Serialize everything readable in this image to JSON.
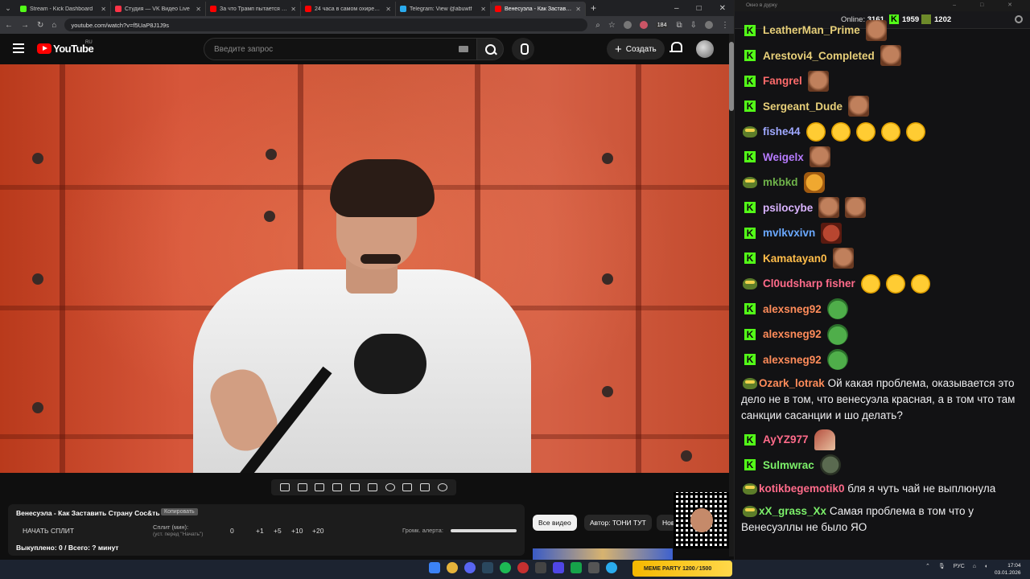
{
  "browser": {
    "tabs": [
      {
        "title": "Stream - Kick Dashboard",
        "color": "#53fc18",
        "active": false
      },
      {
        "title": "Студия — VK Видео Live",
        "color": "#ff3347",
        "active": false
      },
      {
        "title": "За что Трамп пытается убить В",
        "color": "#ff0000",
        "active": false
      },
      {
        "title": "24 часа в самом охиревшем ...",
        "color": "#ff0000",
        "active": false
      },
      {
        "title": "Telegram: View @abuwtf",
        "color": "#2aabee",
        "active": false
      },
      {
        "title": "Венесуэла - Как Заставить ...",
        "color": "#ff0000",
        "active": true
      }
    ],
    "url": "youtube.com/watch?v=f5UaP8J1J9s",
    "ext_badge": "184"
  },
  "youtube": {
    "logo_text": "YouTube",
    "region": "RU",
    "search_placeholder": "Введите запрос",
    "create_label": "Создать"
  },
  "player_panel": {
    "title": "Венесуэла - Как Заставить Страну Сос&ть",
    "copy_label": "Копировать",
    "start_label": "НАЧАТЬ СПЛИТ",
    "split_label": "Сплит (мин):",
    "split_hint": "(уст. перед \"Начать\")",
    "split_value": "0",
    "increments": [
      "+1",
      "+5",
      "+10",
      "+20"
    ],
    "volume_label": "Громк. алерта:",
    "volume_level": 1.0,
    "stats": "Выкуплено: 0 / Всего: ? минут"
  },
  "chips": [
    "Все видео",
    "Автор: ТОНИ ТУТ",
    "Новые"
  ],
  "chat": {
    "window_title": "Окно в дурку",
    "online_label": "Online:",
    "online_count": "3161",
    "kick_count": "1959",
    "points_count": "1202",
    "messages": [
      {
        "badge": "kick",
        "user": "LeatherMan_Prime",
        "color": "#e8d07a",
        "emotes": [
          "face"
        ],
        "text": ""
      },
      {
        "badge": "kick",
        "user": "Arestovi4_Completed",
        "color": "#e8d07a",
        "emotes": [
          "face"
        ],
        "text": ""
      },
      {
        "badge": "kick",
        "user": "Fangrel",
        "color": "#ff6b6b",
        "emotes": [
          "face"
        ],
        "text": ""
      },
      {
        "badge": "kick",
        "user": "Sergeant_Dude",
        "color": "#e8d07a",
        "emotes": [
          "face"
        ],
        "text": ""
      },
      {
        "badge": "pepe",
        "user": "fishe44",
        "color": "#9fa8ff",
        "emotes": [
          "lol",
          "lol",
          "lol",
          "lol",
          "lol"
        ],
        "text": ""
      },
      {
        "badge": "kick",
        "user": "Weigelx",
        "color": "#b77bff",
        "emotes": [
          "face"
        ],
        "text": ""
      },
      {
        "badge": "pepe",
        "user": "mkbkd",
        "color": "#6fb34a",
        "emotes": [
          "tiger"
        ],
        "text": ""
      },
      {
        "badge": "kick",
        "user": "psilocybe",
        "color": "#d9b3ff",
        "emotes": [
          "face",
          "face"
        ],
        "text": ""
      },
      {
        "badge": "kick",
        "user": "mvlkvxivn",
        "color": "#6aa8ff",
        "emotes": [
          "red"
        ],
        "text": ""
      },
      {
        "badge": "kick",
        "user": "Kamatayan0",
        "color": "#ffbd4a",
        "emotes": [
          "face"
        ],
        "text": ""
      },
      {
        "badge": "pepe",
        "user": "Cl0udsharp fisher",
        "color": "#ff6b8a",
        "emotes": [
          "lol",
          "lol",
          "lol"
        ],
        "text": ""
      },
      {
        "badge": "kick",
        "user": "alexsneg92",
        "color": "#ff8c5a",
        "emotes": [
          "frog"
        ],
        "text": ""
      },
      {
        "badge": "kick",
        "user": "alexsneg92",
        "color": "#ff8c5a",
        "emotes": [
          "frog"
        ],
        "text": ""
      },
      {
        "badge": "kick",
        "user": "alexsneg92",
        "color": "#ff8c5a",
        "emotes": [
          "frog"
        ],
        "text": ""
      },
      {
        "badge": "pepe",
        "user": "Ozark_lotrak",
        "color": "#ff8c5a",
        "emotes": [],
        "text": "Ой какая проблема, оказывается это дело не в том, что венесуэла красная, а в том что там санкции сасанции и шо делать?"
      },
      {
        "badge": "kick",
        "user": "AyYZ977",
        "color": "#ff6b8a",
        "emotes": [
          "hand"
        ],
        "text": ""
      },
      {
        "badge": "kick",
        "user": "Sulmwrac",
        "color": "#7cf06a",
        "emotes": [
          "alien"
        ],
        "text": ""
      },
      {
        "badge": "pepe",
        "user": "kotikbegemotik0",
        "color": "#ff6b8a",
        "emotes": [],
        "text": "бля я чуть чай не выплюнула"
      },
      {
        "badge": "pepe",
        "user": "xX_grass_Xx",
        "color": "#7cf06a",
        "emotes": [],
        "text": "Самая проблема в том что у Венесуэллы не было ЯО"
      }
    ]
  },
  "taskbar": {
    "meme_label": "MEME PARTY",
    "meme_value": "1200 ⁄ 1500",
    "lang": "РУС",
    "time": "17:04",
    "date": "03.01.2026"
  }
}
